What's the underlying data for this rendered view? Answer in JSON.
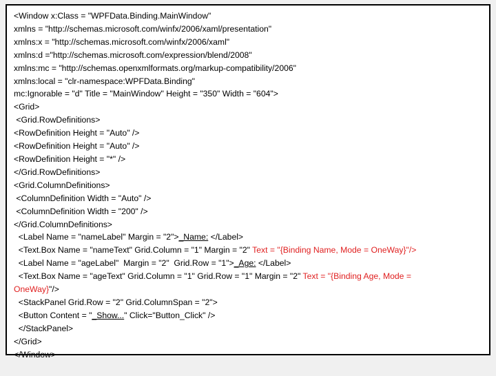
{
  "code": {
    "l01": "<Window x:Class = \"WPFData.Binding.MainWindow\"",
    "l02": "xmlns = \"http://schemas.microsoft.com/winfx/2006/xaml/presentation\"",
    "l03": "xmlns:x = \"http://schemas.microsoft.com/winfx/2006/xaml\"",
    "l04": "xmlns:d =\"http://schemas.microsoft.com/expression/blend/2008\"",
    "l05": "xmlns:mc = \"http://schemas.openxmlformats.org/markup-compatibility/2006\"",
    "l06": "xmlns:local = \"clr-namespace:WPFData.Binding\"",
    "l07": "mc:Ignorable = \"d\" Title = \"MainWindow\" Height = \"350\" Width = \"604\">",
    "l08": "",
    "l09": "<Grid>",
    "l10": " <Grid.RowDefinitions>",
    "l11": "<RowDefinition Height = \"Auto\" />",
    "l12": "<RowDefinition Height = \"Auto\" />",
    "l13": "<RowDefinition Height = \"*\" />",
    "l14": "</Grid.RowDefinitions>",
    "l15": "",
    "l16": "<Grid.ColumnDefinitions>",
    "l17": " <ColumnDefinition Width = \"Auto\" />",
    "l18": " <ColumnDefinition Width = \"200\" />",
    "l19": "</Grid.ColumnDefinitions>",
    "l20": "",
    "l21a": "  <Label Name = \"nameLabel\" Margin = \"2\">",
    "l21u": "_Name:",
    "l21b": " </Label>",
    "l22a": "  <Text.Box Name = \"nameText\" Grid.Column = \"1\" Margin = \"2\" ",
    "l22r": "Text = \"{Binding Name, Mode = OneWay}\"/>",
    "l23a": "  <Label Name = \"ageLabel\"  Margin = \"2\"  Grid.Row = \"1\">",
    "l23u": "_Age:",
    "l23b": " </Label>",
    "l24a": "  <Text.Box Name = \"ageText\" Grid.Column = \"1\" Grid.Row = \"1\" Margin = \"2\" ",
    "l24r": "Text = \"{Binding Age, Mode =",
    "l25r": "OneWay}",
    "l25b": "\"/>",
    "l26": "  <StackPanel Grid.Row = \"2\" Grid.ColumnSpan = \"2\">",
    "l27a": "  <Button Content = \"",
    "l27u": "_Show...",
    "l27b": "\" Click=\"Button_Click\" />",
    "l28": "  </StackPanel>",
    "l29": "</Grid>",
    "l30": "",
    "l31": "</Window>"
  }
}
